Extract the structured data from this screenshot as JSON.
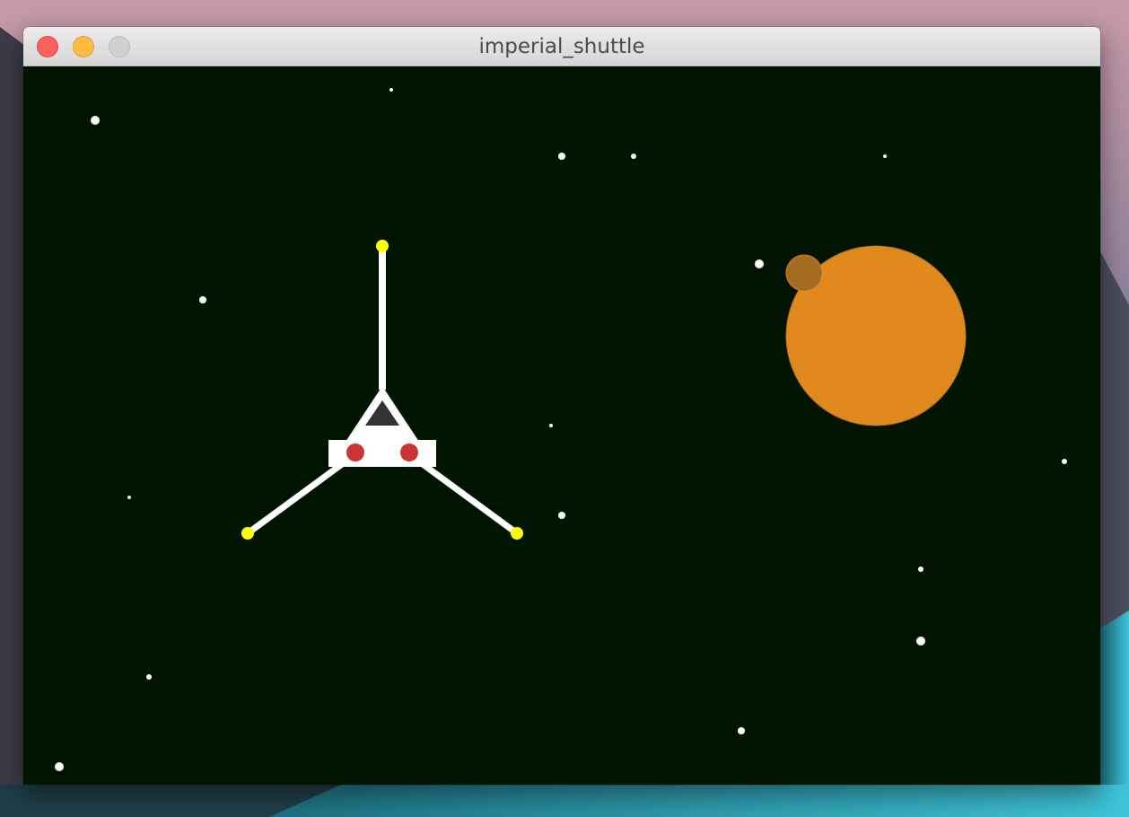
{
  "window": {
    "title": "imperial_shuttle"
  },
  "colors": {
    "space_background": "#001400",
    "star": "#ffffff",
    "shuttle_body": "#ffffff",
    "shuttle_cockpit": "#333333",
    "shuttle_lights": "#cc3333",
    "wing_tips": "#ffff00",
    "planet": "#e08a1e",
    "moon": "#a56c1f"
  },
  "scene": {
    "stars": 21,
    "objects": [
      "shuttle",
      "planet",
      "moon"
    ]
  }
}
